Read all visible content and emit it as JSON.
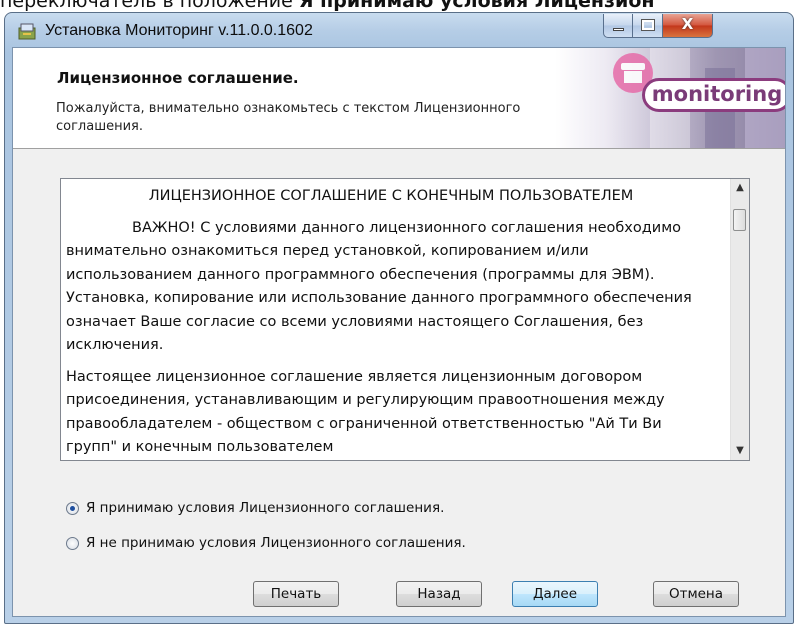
{
  "top_clipped_text": {
    "normal": "переключатель в положение ",
    "bold": "Я принимаю условия Лицензион"
  },
  "window": {
    "title": "Установка Мониторинг v.11.0.0.1602",
    "controls": {
      "close_glyph": "X"
    }
  },
  "header": {
    "title": "Лицензионное соглашение.",
    "subtitle": "Пожалуйста, внимательно ознакомьтесь с текстом Лицензионного соглашения.",
    "logo_text": "monitoring"
  },
  "license": {
    "heading": "ЛИЦЕНЗИОННОЕ СОГЛАШЕНИЕ С КОНЕЧНЫМ ПОЛЬЗОВАТЕЛЕМ",
    "paragraph1": "ВАЖНО! С условиями данного лицензионного соглашения необходимо внимательно ознакомиться перед установкой, копированием и/или использованием данного программного обеспечения (программы для ЭВМ). Установка, копирование или использование данного программного обеспечения означает Ваше согласие со всеми условиями настоящего Соглашения, без исключения.",
    "paragraph2": "Настоящее лицензионное соглашение является лицензионным договором присоединения, устанавливающим и регулирующим правоотношения между правообладателем - обществом с ограниченной ответственностью \"Ай Ти Ви групп\" и конечным пользователем"
  },
  "options": {
    "accept": "Я принимаю условия Лицензионного соглашения.",
    "decline": "Я не принимаю условия Лицензионного соглашения.",
    "selected": "accept"
  },
  "buttons": {
    "print": "Печать",
    "back": "Назад",
    "next": "Далее",
    "cancel": "Отмена"
  }
}
